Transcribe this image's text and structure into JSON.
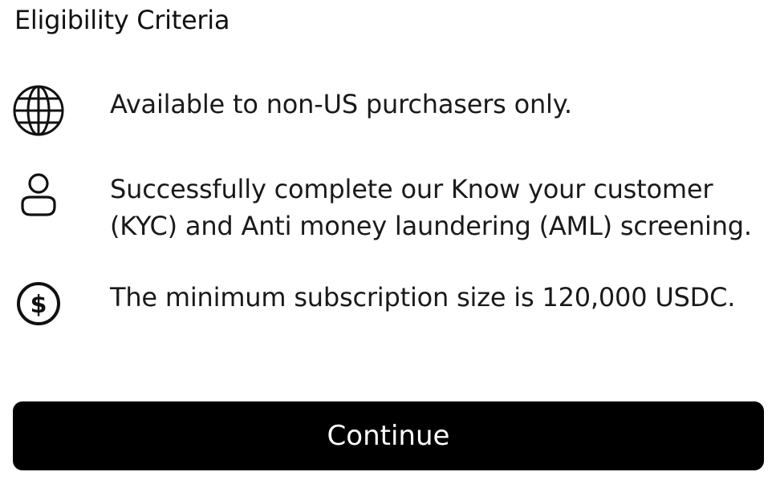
{
  "title": "Eligibility Criteria",
  "criteria": [
    {
      "icon": "globe-icon",
      "text": "Available to non-US purchasers only."
    },
    {
      "icon": "user-icon",
      "text": "Successfully complete our Know your customer (KYC) and Anti money laundering (AML) screening."
    },
    {
      "icon": "dollar-circle-icon",
      "text": "The minimum subscription size is 120,000 USDC."
    }
  ],
  "continue_label": "Continue",
  "colors": {
    "button_background": "#000000",
    "button_text": "#ffffff",
    "text": "#111111"
  }
}
